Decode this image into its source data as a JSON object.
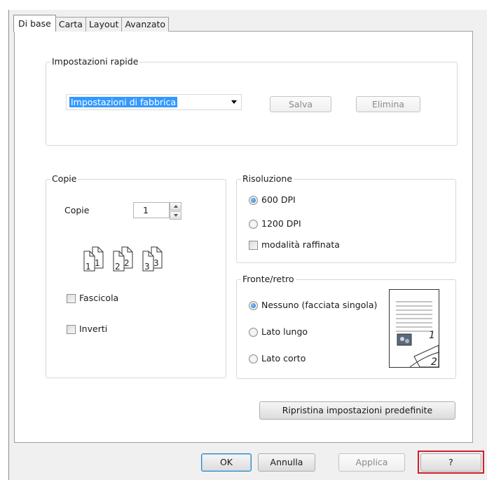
{
  "tabs": [
    "Di base",
    "Carta",
    "Layout",
    "Avanzato"
  ],
  "quick": {
    "legend": "Impostazioni rapide",
    "selected": "Impostazioni di fabbrica",
    "save": "Salva",
    "delete": "Elimina"
  },
  "copies": {
    "legend": "Copie",
    "label": "Copie",
    "value": "1",
    "collate_numbers": [
      "1",
      "1",
      "2",
      "2",
      "3",
      "3"
    ],
    "collate": "Fascicola",
    "reverse": "Inverti"
  },
  "resolution": {
    "legend": "Risoluzione",
    "options": [
      "600 DPI",
      "1200 DPI"
    ],
    "selected": "600 DPI",
    "refined": "modalità raffinata"
  },
  "duplex": {
    "legend": "Fronte/retro",
    "options": [
      "Nessuno (facciata singola)",
      "Lato lungo",
      "Lato corto"
    ],
    "selected": "Nessuno (facciata singola)",
    "preview_pages": [
      "1",
      "2"
    ]
  },
  "restore": "Ripristina impostazioni predefinite",
  "footer": {
    "ok": "OK",
    "cancel": "Annulla",
    "apply": "Applica",
    "help": "?"
  },
  "colors": {
    "selection": "#3399ff",
    "highlight": "#d0202a",
    "group_border": "#d3d8dc"
  }
}
